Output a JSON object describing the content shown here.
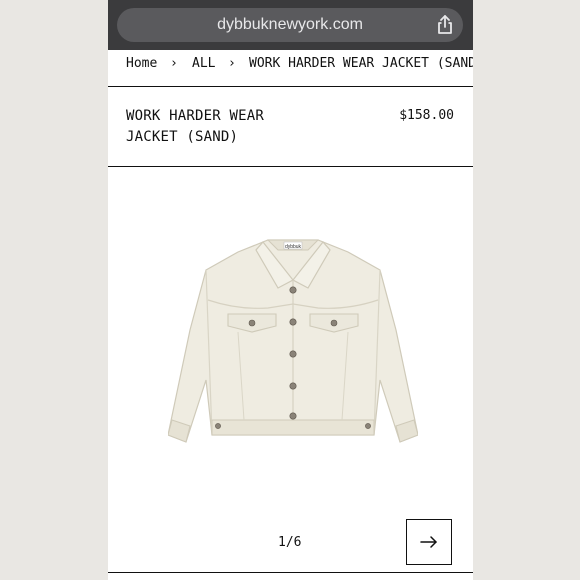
{
  "browser": {
    "url": "dybbuknewyork.com",
    "share_icon": "share-icon"
  },
  "breadcrumb": {
    "items": [
      "Home",
      "ALL",
      "WORK HARDER WEAR JACKET (SAND)"
    ],
    "separator": "›"
  },
  "product": {
    "title_line1": "WORK HARDER WEAR",
    "title_line2": "JACKET (SAND)",
    "price": "$158.00",
    "jacket_label": "dybbuk"
  },
  "gallery": {
    "pager": "1/6",
    "next_icon": "arrow-right-icon"
  },
  "colors": {
    "jacket": "#efece1",
    "jacket_shade": "#d9d5c6",
    "text": "#111111",
    "browser_bar": "#3b3b3d"
  }
}
